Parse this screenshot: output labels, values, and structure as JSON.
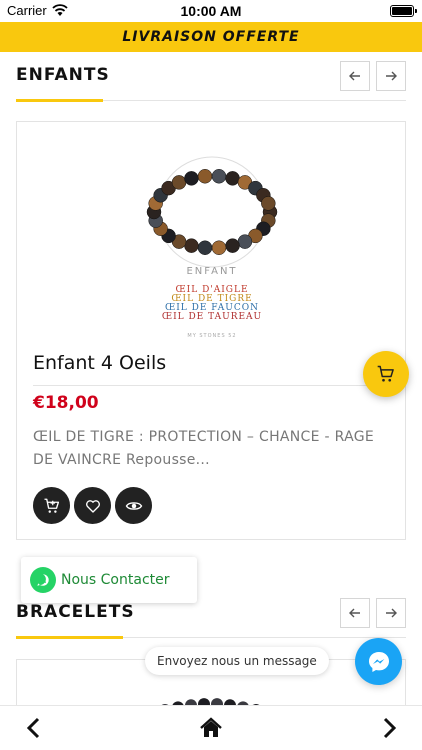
{
  "status_bar": {
    "carrier": "Carrier",
    "time": "10:00 AM"
  },
  "banner": {
    "text": "LIVRAISON OFFERTE"
  },
  "section_enfants": {
    "title": "ENFANTS"
  },
  "product": {
    "name": "Enfant 4 Oeils",
    "price": "€18,00",
    "description": "ŒIL DE TIGRE : PROTECTION – CHANCE - RAGE DE VAINCRE Repousse...",
    "image_text": {
      "caption": "ENFANT",
      "lines": [
        "ŒIL D'AIGLE",
        "ŒIL DE TIGRE",
        "ŒIL DE FAUCON",
        "ŒIL DE TAUREAU"
      ],
      "brand": "MY STONES 52"
    }
  },
  "contact": {
    "label": "Nous Contacter"
  },
  "section_bracelets": {
    "title": "BRACELETS"
  },
  "messenger": {
    "bubble": "Envoyez nous un message"
  },
  "icons": {
    "prev": "arrow-left-icon",
    "next": "arrow-right-icon",
    "cart": "cart-icon",
    "heart": "heart-icon",
    "eye": "eye-icon",
    "whatsapp": "whatsapp-icon",
    "messenger": "messenger-icon",
    "home": "home-icon"
  },
  "colors": {
    "accent": "#f9c80e",
    "price": "#d0021b",
    "whatsapp": "#25d366",
    "messenger": "#1aa4f5"
  }
}
